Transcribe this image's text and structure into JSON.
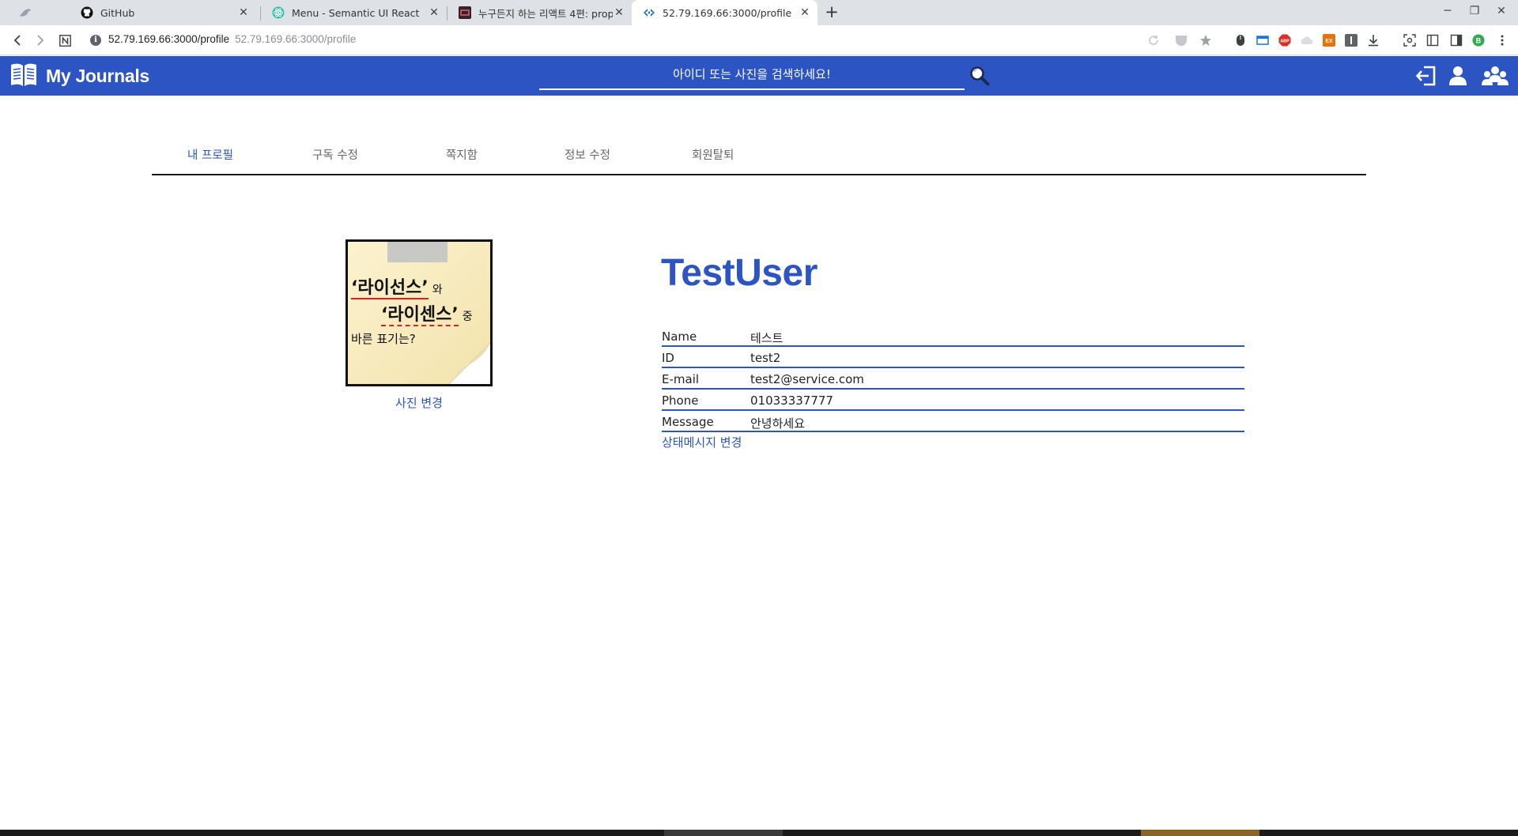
{
  "browser": {
    "tabs": [
      {
        "title": "",
        "icon": "bird-icon"
      },
      {
        "title": "GitHub",
        "icon": "github-icon"
      },
      {
        "title": "Menu - Semantic UI React",
        "icon": "react-icon"
      },
      {
        "title": "누구든지 하는 리액트 4편: prop",
        "icon": "velopert-icon"
      },
      {
        "title": "52.79.169.66:3000/profile",
        "icon": "app-icon",
        "active": true
      }
    ],
    "url_host": "52.79.169.66:3000/profile",
    "url_ghost": "52.79.169.66:3000/profile",
    "extensions": [
      "reload-icon",
      "pocket-icon",
      "bookmark-star-icon",
      "mouse-icon",
      "window-icon",
      "adblock-icon",
      "cloud-icon",
      "ex-icon",
      "i-icon",
      "download-icon",
      "screenshot-icon",
      "reader-icon",
      "sidebar-icon",
      "profile-b-icon",
      "menu-icon"
    ],
    "profile_letter": "B",
    "adblock_label": "ABP",
    "ex_label": "EX"
  },
  "app": {
    "brand": "My Journals",
    "search_placeholder": "아이디 또는 사진을 검색하세요!",
    "accent": "#2c54c2"
  },
  "profile_menu": [
    {
      "label": "내 프로필",
      "active": true
    },
    {
      "label": "구독 수정"
    },
    {
      "label": "쪽지함"
    },
    {
      "label": "정보 수정"
    },
    {
      "label": "회원탈퇴"
    }
  ],
  "photo": {
    "line1_main": "‘라이선스’",
    "line1_suffix": "와",
    "line2_main": "‘라이센스’",
    "line2_suffix": "중",
    "line3": "바른 표기는?",
    "change_label": "사진 변경"
  },
  "user": {
    "display_name": "TestUser",
    "fields": [
      {
        "key": "Name",
        "value": "테스트"
      },
      {
        "key": "ID",
        "value": "test2"
      },
      {
        "key": "E-mail",
        "value": "test2@service.com"
      },
      {
        "key": "Phone",
        "value": "01033337777"
      },
      {
        "key": "Message",
        "value": "안녕하세요"
      }
    ],
    "status_change_label": "상태메시지 변경"
  }
}
